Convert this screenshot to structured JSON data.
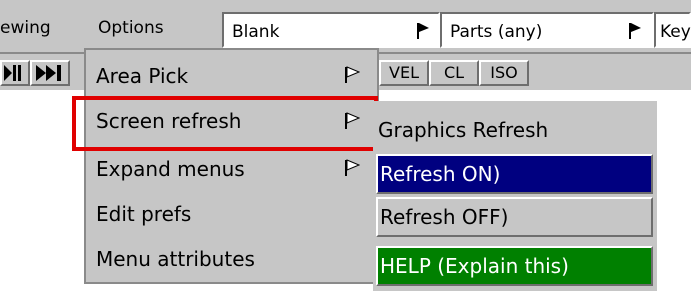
{
  "menubar": {
    "viewing_label": "ewing",
    "options_label": "Options",
    "blank_select": "Blank",
    "parts_select": "Parts (any)",
    "key_select": "Key"
  },
  "toolbar2": {
    "vel_label": "VEL",
    "cl_label": "CL",
    "iso_label": "ISO"
  },
  "options_menu": {
    "items": [
      {
        "label": "Area Pick",
        "has_submenu": true
      },
      {
        "label": "Screen refresh",
        "has_submenu": true,
        "highlighted": true
      },
      {
        "label": "Expand menus",
        "has_submenu": true
      },
      {
        "label": "Edit prefs",
        "has_submenu": false
      },
      {
        "label": "Menu attributes",
        "has_submenu": false
      }
    ]
  },
  "screen_refresh_submenu": {
    "items": [
      {
        "label": "Graphics Refresh"
      },
      {
        "label": "Refresh ON)",
        "state": "active"
      },
      {
        "label": "Refresh OFF)"
      },
      {
        "label": "HELP (Explain this)"
      }
    ]
  },
  "colors": {
    "active_bg": "#000080",
    "help_bg": "#008000",
    "highlight_border": "#e00000",
    "menu_bg": "#c6c6c6"
  },
  "icons": {
    "submenu_indicator": "flag-arrow-icon",
    "skip_start": "skip-start-icon",
    "skip_end": "skip-end-icon"
  }
}
